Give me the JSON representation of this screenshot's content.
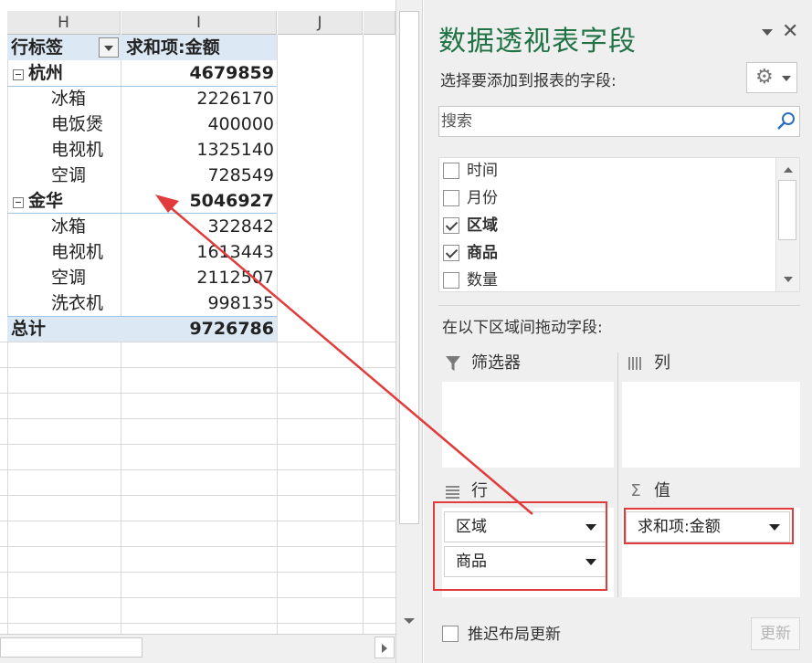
{
  "sheet": {
    "columns": [
      "H",
      "I",
      "J"
    ],
    "pivot": {
      "header_row_label": "行标签",
      "header_value_label": "求和项:金额",
      "groups": [
        {
          "name": "杭州",
          "total": "4679859",
          "items": [
            {
              "name": "冰箱",
              "value": "2226170"
            },
            {
              "name": "电饭煲",
              "value": "400000"
            },
            {
              "name": "电视机",
              "value": "1325140"
            },
            {
              "name": "空调",
              "value": "728549"
            }
          ]
        },
        {
          "name": "金华",
          "total": "5046927",
          "items": [
            {
              "name": "冰箱",
              "value": "322842"
            },
            {
              "name": "电视机",
              "value": "1613443"
            },
            {
              "name": "空调",
              "value": "2112507"
            },
            {
              "name": "洗衣机",
              "value": "998135"
            }
          ]
        }
      ],
      "grand_total_label": "总计",
      "grand_total_value": "9726786"
    }
  },
  "pane": {
    "title": "数据透视表字段",
    "choose_fields_label": "选择要添加到报表的字段:",
    "search_placeholder": "搜索",
    "fields": [
      {
        "label": "时间",
        "checked": false
      },
      {
        "label": "月份",
        "checked": false
      },
      {
        "label": "区域",
        "checked": true
      },
      {
        "label": "商品",
        "checked": true
      },
      {
        "label": "数量",
        "checked": false
      }
    ],
    "drag_label": "在以下区域间拖动字段:",
    "areas": {
      "filters": {
        "label": "筛选器",
        "icon": "funnel-icon"
      },
      "columns": {
        "label": "列",
        "icon": "columns-icon"
      },
      "rows": {
        "label": "行",
        "icon": "rows-icon",
        "items": [
          "区域",
          "商品"
        ]
      },
      "values": {
        "label": "值",
        "icon": "sigma-icon",
        "items": [
          "求和项:金额"
        ]
      }
    },
    "defer_label": "推迟布局更新",
    "update_label": "更新"
  },
  "colors": {
    "title_green": "#217346",
    "annotation_red": "#e23b3b",
    "pivot_band": "#dce9f5"
  }
}
